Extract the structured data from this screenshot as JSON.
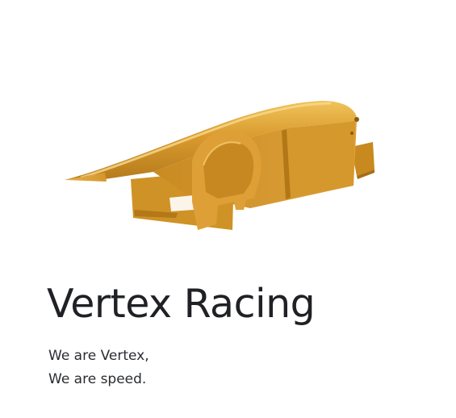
{
  "hero": {
    "image_subject": "gold-race-car-nose-cone",
    "body_color": "#d4962a",
    "shadow_color": "#9c6a14",
    "highlight_color": "#f2c45c",
    "title": "Vertex Racing",
    "tagline_lines": [
      "We are Vertex,",
      "We are speed."
    ]
  },
  "colors": {
    "background": "#ffffff",
    "text": "#1f2125"
  }
}
